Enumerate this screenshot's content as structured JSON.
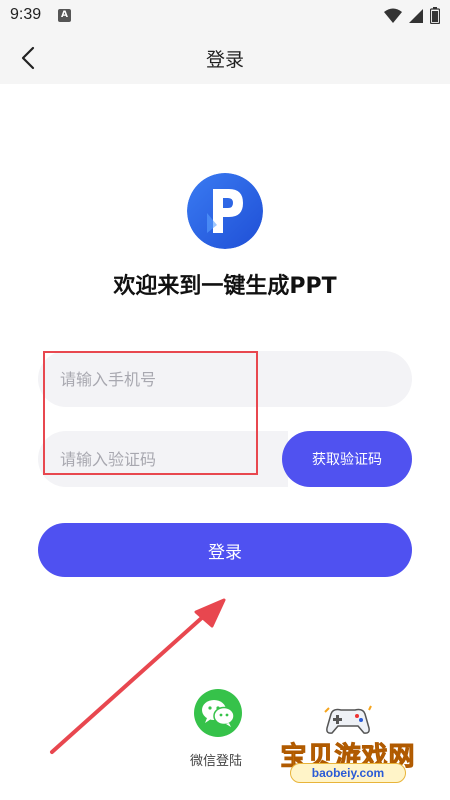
{
  "status_bar": {
    "time": "9:39",
    "notification_glyph": "A"
  },
  "header": {
    "title": "登录"
  },
  "welcome_text": "欢迎来到一键生成PPT",
  "form": {
    "phone_placeholder": "请输入手机号",
    "code_placeholder": "请输入验证码",
    "get_code_label": "获取验证码",
    "login_label": "登录"
  },
  "social": {
    "wechat_label": "微信登陆"
  },
  "watermark": {
    "text": "宝贝游戏网",
    "url": "baobeiy.com"
  },
  "colors": {
    "primary": "#4f51f1",
    "annotation_red": "#e8474f",
    "wechat_green": "#36c24a",
    "logo_blue": "#2f66e8"
  }
}
